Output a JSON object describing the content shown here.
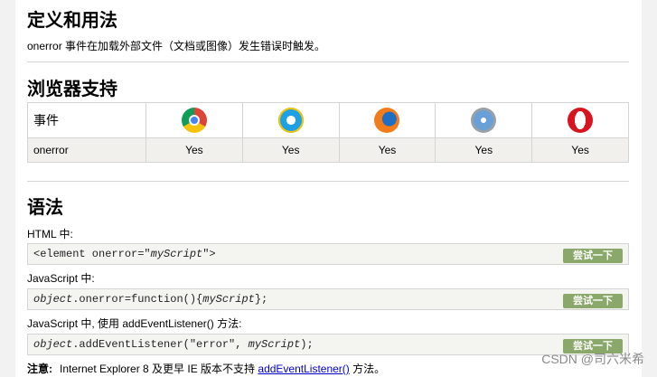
{
  "section1": {
    "title": "定义和用法",
    "description": "onerror 事件在加载外部文件（文档或图像）发生错误时触发。"
  },
  "section2": {
    "title": "浏览器支持",
    "table": {
      "header": [
        "事件"
      ],
      "browsers": [
        "chrome-icon",
        "ie-icon",
        "firefox-icon",
        "safari-icon",
        "opera-icon"
      ],
      "row": {
        "event": "onerror",
        "support": [
          "Yes",
          "Yes",
          "Yes",
          "Yes",
          "Yes"
        ]
      }
    }
  },
  "section3": {
    "title": "语法",
    "html_label": "HTML 中:",
    "html_code_prefix": "<element onerror=\"",
    "html_code_italic": "myScript",
    "html_code_suffix": "\">",
    "js_label": "JavaScript 中:",
    "js_code_italic1": "object",
    "js_code_mid": ".onerror=function(){",
    "js_code_italic2": "myScript",
    "js_code_suffix": "};",
    "listener_label": "JavaScript 中, 使用 addEventListener() 方法:",
    "listener_code_italic1": "object",
    "listener_code_mid": ".addEventListener(\"error\", ",
    "listener_code_italic2": "myScript",
    "listener_code_suffix": ");",
    "try_button": "尝试一下"
  },
  "note": {
    "label": "注意:",
    "text_before": "Internet Explorer 8 及更早 IE 版本不支持",
    "link": "addEventListener()",
    "text_after": "方法。"
  },
  "watermark": "CSDN @司六米希"
}
